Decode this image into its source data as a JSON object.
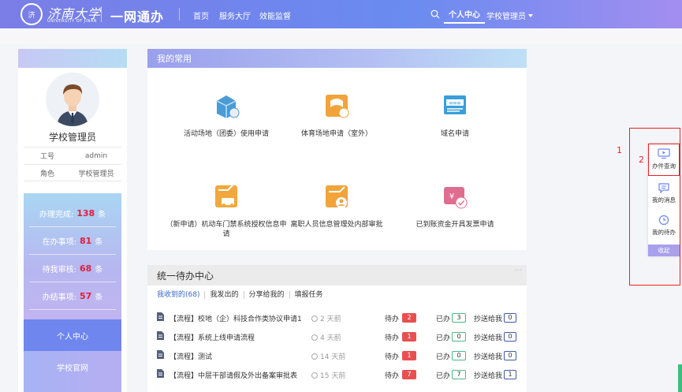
{
  "header": {
    "logo_badge": "济",
    "logo_text": "济南大学",
    "logo_sub": "UNIVERSITY OF JINAN",
    "system_title": "一网通办",
    "nav": [
      "首页",
      "服务大厅",
      "效能监督"
    ],
    "active_nav": "个人中心",
    "user_menu": "学校管理员"
  },
  "sidebar": {
    "user_name": "学校管理员",
    "info": [
      {
        "key": "工号",
        "value": "admin"
      },
      {
        "key": "角色",
        "value": "学校管理员"
      }
    ],
    "stats": [
      {
        "label": "办理完成:",
        "count": "138",
        "unit": "条"
      },
      {
        "label": "在办事项:",
        "count": "81",
        "unit": "条"
      },
      {
        "label": "待我审核:",
        "count": "68",
        "unit": "条"
      },
      {
        "label": "办结事项:",
        "count": "57",
        "unit": "条"
      }
    ],
    "nav_active": "个人中心",
    "nav_next": "学校官网"
  },
  "favorites": {
    "title": "我的常用",
    "items": [
      {
        "label": "活动场地（团委）使用申请",
        "icon": "building-icon"
      },
      {
        "label": "体育场地申请（室外）",
        "icon": "stadium-icon"
      },
      {
        "label": "域名申请",
        "icon": "www-icon"
      },
      {
        "label": "（新申请）机动车门禁系统授权信息申请",
        "icon": "car-icon"
      },
      {
        "label": "离职人员信息管理处内部审批",
        "icon": "person-icon"
      },
      {
        "label": "已到账资金开具发票申请",
        "icon": "invoice-icon"
      }
    ]
  },
  "todo": {
    "title": "统一待办中心",
    "dots": "···",
    "tabs": [
      "我收到的(68)",
      "我发出的",
      "分享给我的",
      "填报任务"
    ],
    "labels": {
      "pending": "待办",
      "done": "已办",
      "cc": "抄送给我"
    },
    "rows": [
      {
        "title": "【流程】校地（企）科技合作类协议申请1",
        "time": "2 天前",
        "pending": "2",
        "done": "3",
        "cc": "0"
      },
      {
        "title": "【流程】系统上线申请流程",
        "time": "4 天前",
        "pending": "1",
        "done": "0",
        "cc": "0"
      },
      {
        "title": "【流程】测试",
        "time": "14 天前",
        "pending": "1",
        "done": "0",
        "cc": "0"
      },
      {
        "title": "【流程】中层干部请假及外出备案审批表",
        "time": "15 天前",
        "pending": "7",
        "done": "7",
        "cc": "1"
      }
    ]
  },
  "float_toolbar": {
    "items": [
      "办件查询",
      "我的消息",
      "我的待办"
    ],
    "collapse": "收起"
  },
  "annotations": {
    "one": "1",
    "two": "2"
  }
}
